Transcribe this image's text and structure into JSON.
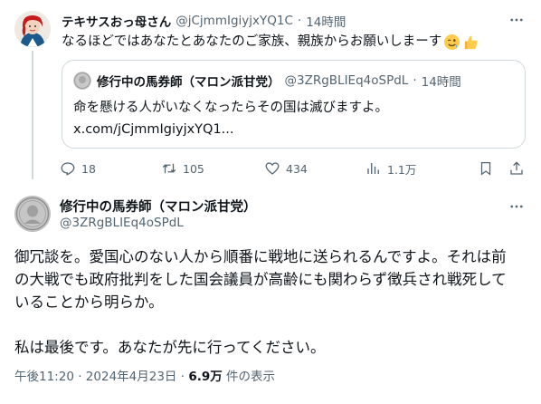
{
  "parent_tweet": {
    "display_name": "テキサスおっ母さん",
    "handle": "@jCjmmIgiyjxYQ1C",
    "separator": "·",
    "time": "14時間",
    "text": "なるほどではあなたとあなたのご家族、親族からお願いしまーす",
    "emoji": [
      "winking-face-emoji",
      "thumbs-up-emoji"
    ],
    "quote": {
      "display_name": "修行中の馬券師（マロン派甘党）",
      "handle": "@3ZRgBLIEq4oSPdL",
      "separator": "·",
      "time": "14時間",
      "text_line1": "命を懸ける人がいなくなったらその国は滅びますよ。",
      "text_line2": "x.com/jCjmmIgiyjxYQ1..."
    },
    "actions": {
      "reply_count": "18",
      "retweet_count": "105",
      "like_count": "434",
      "view_count": "1.1万"
    }
  },
  "main_tweet": {
    "display_name": "修行中の馬券師（マロン派甘党）",
    "handle": "@3ZRgBLIEq4oSPdL",
    "text_lines": [
      "御冗談を。愛国心のない人から順番に戦地に送られるんですよ。それは前",
      "の大戦でも政府批判をした国会議員が高齢にも関わらず徴兵され戦死して",
      "いることから明らか。",
      "私は最後です。あなたが先に行ってください。"
    ],
    "meta": {
      "time": "午後11:20",
      "separator": "·",
      "date": "2024年4月23日",
      "views_count": "6.9万",
      "views_label": "件の表示"
    }
  },
  "colors": {
    "text_primary": "#0f1419",
    "text_secondary": "#536471",
    "border": "#cfd9de"
  }
}
